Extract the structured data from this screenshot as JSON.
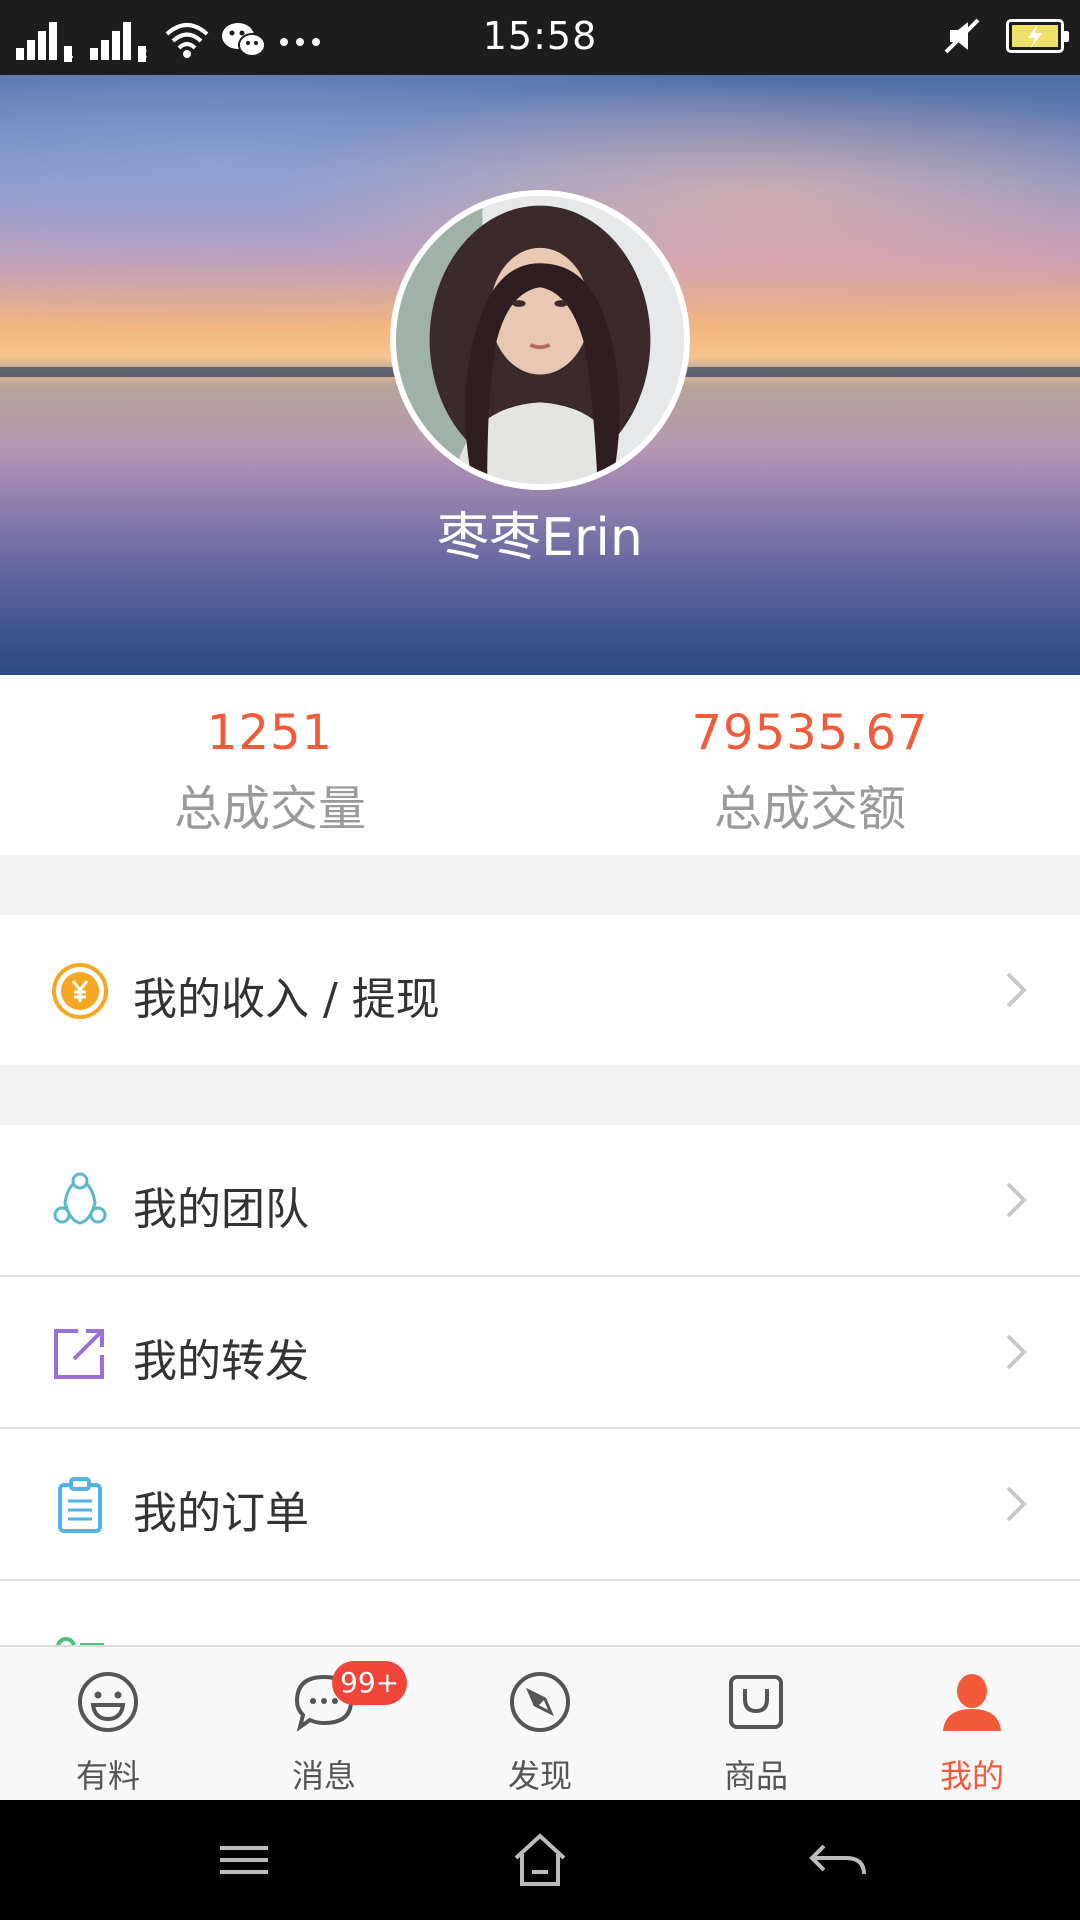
{
  "status_bar": {
    "time": "15:58",
    "sim1": "1",
    "sim2": "2",
    "icons": [
      "signal-icon",
      "signal-icon",
      "wifi-icon",
      "wechat-icon",
      "more-icon",
      "mute-icon",
      "battery-icon"
    ]
  },
  "profile": {
    "username": "枣枣Erin"
  },
  "stats": {
    "count_value": "1251",
    "count_label": "总成交量",
    "amount_value": "79535.67",
    "amount_label": "总成交额"
  },
  "menu": {
    "income": "我的收入 / 提现",
    "team": "我的团队",
    "forward": "我的转发",
    "orders": "我的订单"
  },
  "tabs": {
    "items": [
      {
        "label": "有料",
        "icon": "smiley-icon"
      },
      {
        "label": "消息",
        "icon": "chat-icon",
        "badge": "99+"
      },
      {
        "label": "发现",
        "icon": "compass-icon"
      },
      {
        "label": "商品",
        "icon": "shopping-bag-icon"
      },
      {
        "label": "我的",
        "icon": "user-icon"
      }
    ]
  },
  "colors": {
    "accent": "#f25a3a",
    "income_icon": "#f5a623",
    "team_icon": "#5bb8c9",
    "forward_icon": "#9b6fd6",
    "orders_icon": "#4fb3e8"
  }
}
